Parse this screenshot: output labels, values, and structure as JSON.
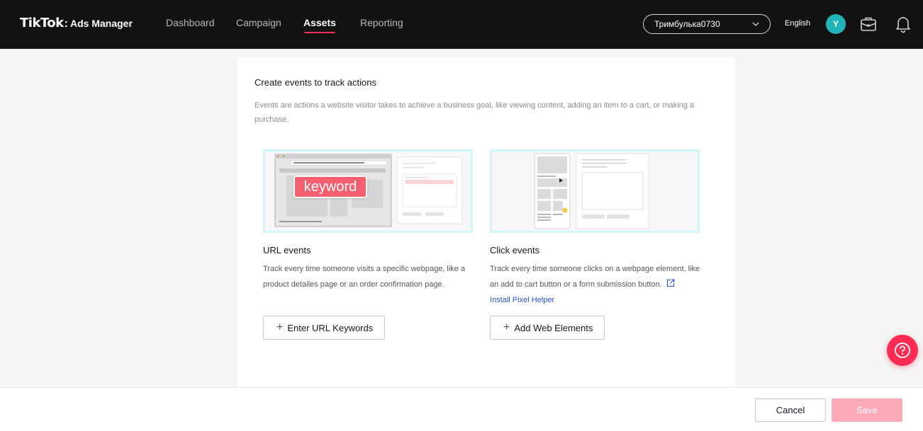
{
  "nav": {
    "logo_main": "TikTok",
    "logo_sub": "Ads Manager",
    "tabs": [
      "Dashboard",
      "Campaign",
      "Assets",
      "Reporting"
    ],
    "active_tab": "Assets",
    "account": "Тримбулька0730",
    "language": "English",
    "avatar_initial": "Y",
    "icons": [
      "briefcase-icon",
      "bell-icon"
    ]
  },
  "main": {
    "title": "Create events to track actions",
    "description": "Events are actions a website visitor takes to achieve a business goal, like viewing content, adding an item to a cart, or making a purchase.",
    "url_events": {
      "title": "URL events",
      "description": "Track every time someone visits a specific webpage, like a product detailes page or an order confirmation page.",
      "illustration_keyword": "keyword",
      "button_label": "Enter URL Keywords"
    },
    "click_events": {
      "title": "Click events",
      "description": "Track every time someone clicks on a webpage element, like an add to cart button or a form submission button.",
      "link_label": "Install Pixel Helper",
      "button_label": "Add Web Elements"
    }
  },
  "footer": {
    "cancel_label": "Cancel",
    "save_label": "Save"
  },
  "colors": {
    "accent": "#fe2c55",
    "nav_bg": "#121212",
    "avatar": "#20b4b8",
    "save_disabled": "#feaab9",
    "illustration_border": "#cff6f8"
  }
}
